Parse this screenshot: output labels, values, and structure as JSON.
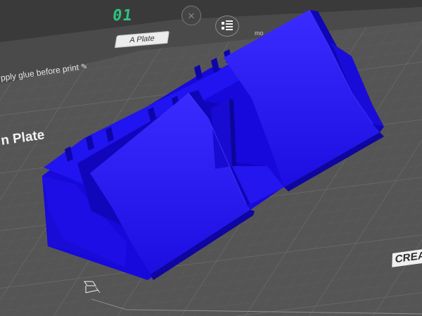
{
  "plate": {
    "index": "01",
    "tab_label": "A Plate",
    "name": "n Plate",
    "glue_note": "pply glue before print"
  },
  "toolbar": {
    "close_glyph": "×",
    "more_label": "mo"
  },
  "bed": {
    "brand": "CREA"
  },
  "model": {
    "color": "#1e10ee"
  },
  "icons": {
    "close": "close-icon",
    "arrange": "arrange-icon",
    "edit": "pencil-icon",
    "origin": "origin-axis-icon"
  },
  "colors": {
    "background": "#3a3a3a",
    "bed": "#555555",
    "grid": "#666666",
    "plate_index": "#2ec27e",
    "model": "#1e10ee"
  }
}
